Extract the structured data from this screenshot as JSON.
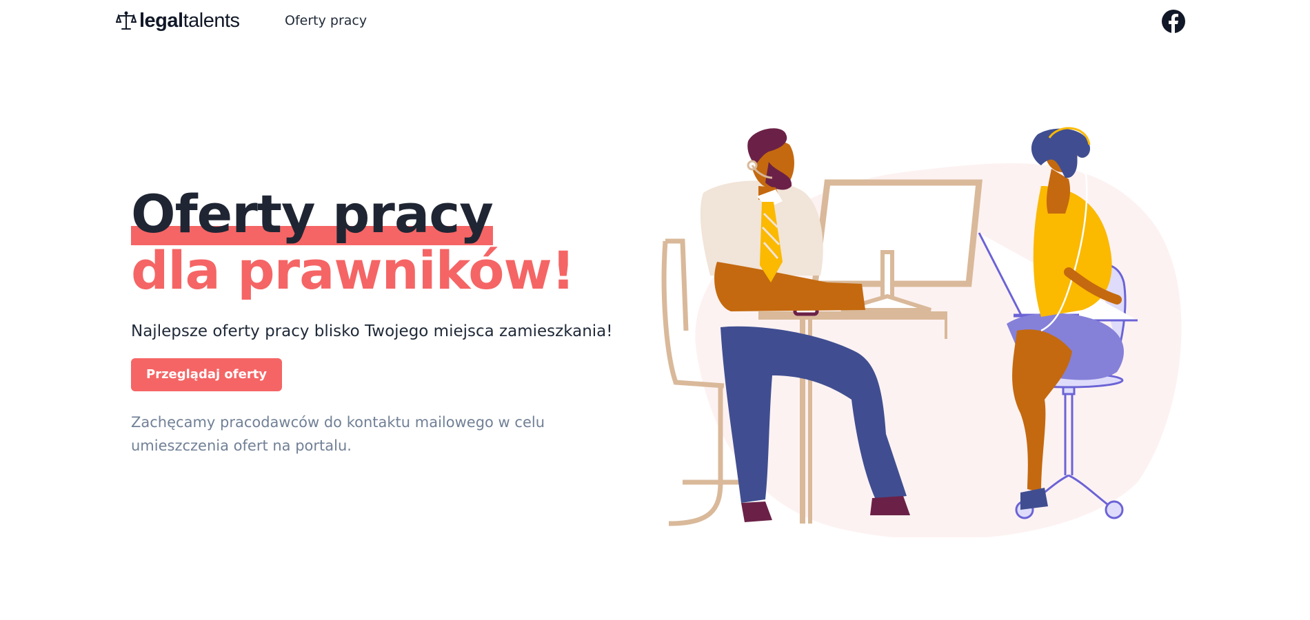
{
  "header": {
    "logo": {
      "bold": "legal",
      "light": "talents"
    },
    "nav": [
      {
        "label": "Oferty pracy"
      }
    ],
    "social_icon": "facebook-icon"
  },
  "hero": {
    "title_line1": "Oferty pracy",
    "title_line2": "dla prawników!",
    "subtitle": "Najlepsze oferty pracy blisko Twojego miejsca zamieszkania!",
    "cta_label": "Przeglądaj oferty",
    "note": "Zachęcamy pracodawców do kontaktu mailowego w celu umieszczenia ofert na portalu."
  },
  "colors": {
    "accent": "#f56565",
    "title": "#1f2533",
    "muted": "#718096",
    "blob": "#fdf2f2"
  }
}
